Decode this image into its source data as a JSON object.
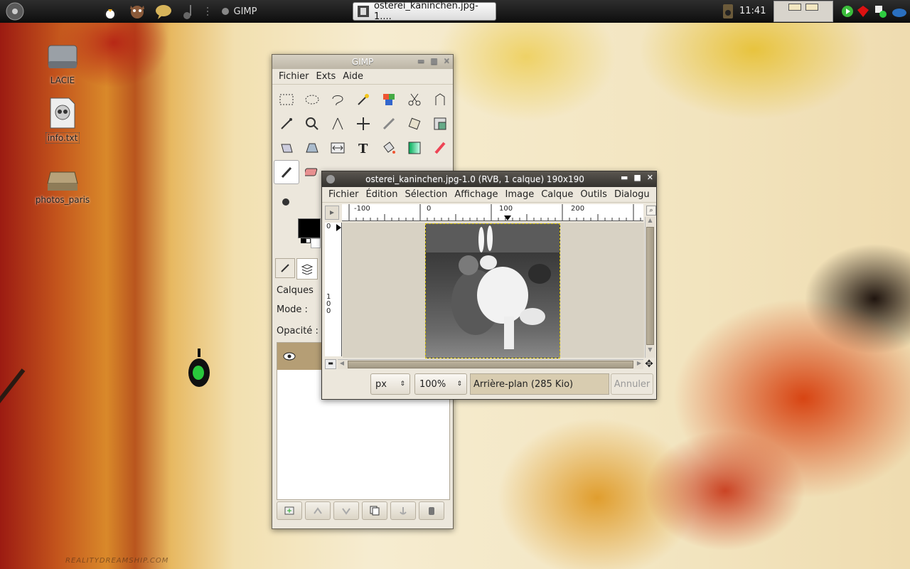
{
  "panel": {
    "app_label": "GIMP",
    "task_title": "osterei_kaninchen.jpg-1....",
    "clock": "11:41"
  },
  "desktop": {
    "icons": [
      {
        "label": "LACIE",
        "icon": "drive-icon"
      },
      {
        "label": "info.txt",
        "icon": "skull-file-icon"
      },
      {
        "label": "photos_paris",
        "icon": "drive-icon"
      }
    ],
    "watermark": "REALITYDREAMSHIP.COM"
  },
  "toolbox": {
    "title": "GIMP",
    "menu": [
      "Fichier",
      "Exts",
      "Aide"
    ],
    "layers_label": "Calques",
    "mode_label": "Mode :",
    "opacity_label": "Opacité :"
  },
  "image_window": {
    "title": "osterei_kaninchen.jpg-1.0 (RVB, 1 calque) 190x190",
    "menu": [
      "Fichier",
      "Édition",
      "Sélection",
      "Affichage",
      "Image",
      "Calque",
      "Outils",
      "Dialogu"
    ],
    "ruler_h": [
      "-100",
      "0",
      "100",
      "200"
    ],
    "ruler_v": [
      "0",
      "1",
      "0",
      "0"
    ],
    "unit": "px",
    "zoom": "100%",
    "status": "Arrière-plan (285 Kio)",
    "cancel": "Annuler"
  }
}
